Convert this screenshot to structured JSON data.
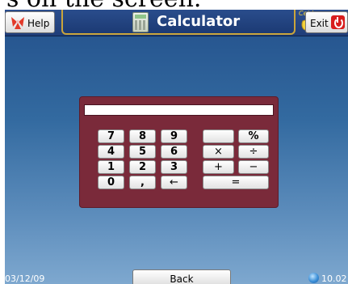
{
  "caption_fragment": "s on the screen.",
  "header": {
    "help_label": "Help",
    "title": "Calculator",
    "exit_label": "Exit",
    "logo_text": "Celdy"
  },
  "calculator": {
    "display_value": "",
    "keys": {
      "k7": "7",
      "k8": "8",
      "k9": "9",
      "blank": "",
      "percent": "%",
      "k4": "4",
      "k5": "5",
      "k6": "6",
      "multiply": "×",
      "divide": "÷",
      "k1": "1",
      "k2": "2",
      "k3": "3",
      "plus": "+",
      "minus": "−",
      "k0": "0",
      "comma": ",",
      "backspace": "←",
      "equals": "="
    }
  },
  "footer": {
    "date": "03/12/09",
    "back_label": "Back",
    "right_text": "10.02"
  },
  "colors": {
    "panel": "#7a2a3a",
    "title_border": "#caa53b"
  }
}
